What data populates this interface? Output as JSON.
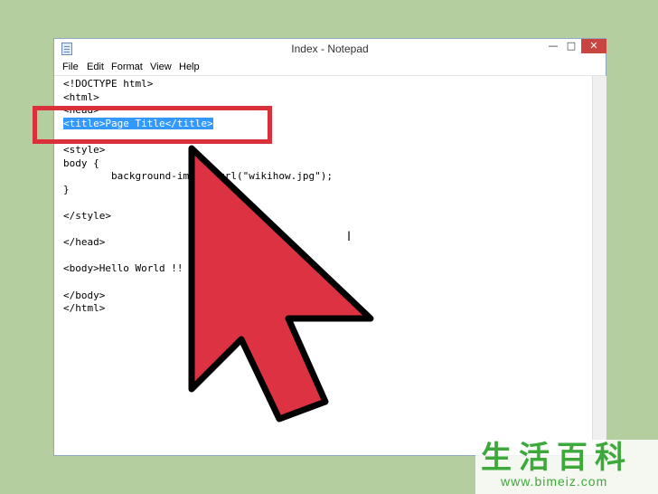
{
  "window": {
    "title": "Index - Notepad",
    "controls": {
      "minimize": "—",
      "maximize": "□",
      "close": "✕"
    }
  },
  "menu": {
    "file": "File",
    "edit": "Edit",
    "format": "Format",
    "view": "View",
    "help": "Help"
  },
  "editor": {
    "lines": [
      "<!DOCTYPE html>",
      "<html>",
      "<head>",
      "<title>Page Title</title>",
      "",
      "<style>",
      "body {",
      "\tbackground-image: url(\"wikihow.jpg\");",
      "}",
      "",
      "</style>",
      "",
      "</head>",
      "",
      "<body>Hello World !!",
      "",
      "</body>",
      "</html>"
    ],
    "selected_line_index": 3,
    "text_cursor_glyph": "I"
  },
  "colors": {
    "background": "#b4cea0",
    "arrow_fill": "#dc3241",
    "arrow_stroke": "#000000",
    "highlight_box": "#d9303a",
    "selection": "#3399ff",
    "watermark": "#3da93a"
  },
  "icons": {
    "app": "notepad-icon",
    "pointer": "mouse-pointer-arrow-icon"
  },
  "watermark": {
    "chars": "生活百科",
    "url": "www.bimeiz.com"
  }
}
